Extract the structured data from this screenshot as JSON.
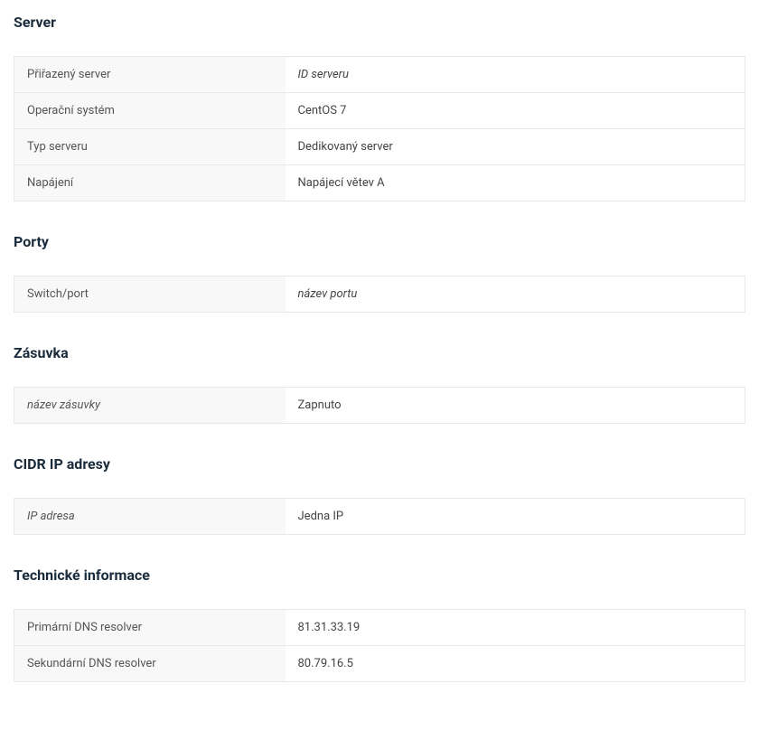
{
  "sections": {
    "server": {
      "title": "Server",
      "rows": [
        {
          "label": "Přiřazený server",
          "value": "ID serveru",
          "valueItalic": true
        },
        {
          "label": "Operační systém",
          "value": "CentOS 7"
        },
        {
          "label": "Typ serveru",
          "value": "Dedikovaný server"
        },
        {
          "label": "Napájení",
          "value": "Napájecí větev A"
        }
      ]
    },
    "ports": {
      "title": "Porty",
      "rows": [
        {
          "label": "Switch/port",
          "value": "název portu",
          "valueItalic": true
        }
      ]
    },
    "socket": {
      "title": "Zásuvka",
      "rows": [
        {
          "label": "název zásuvky",
          "labelItalic": true,
          "value": "Zapnuto"
        }
      ]
    },
    "cidr": {
      "title": "CIDR IP adresy",
      "rows": [
        {
          "label": "IP adresa",
          "labelItalic": true,
          "value": "Jedna IP"
        }
      ]
    },
    "tech": {
      "title": "Technické informace",
      "rows": [
        {
          "label": "Primární DNS resolver",
          "value": "81.31.33.19"
        },
        {
          "label": "Sekundární DNS resolver",
          "value": "80.79.16.5"
        }
      ]
    }
  }
}
